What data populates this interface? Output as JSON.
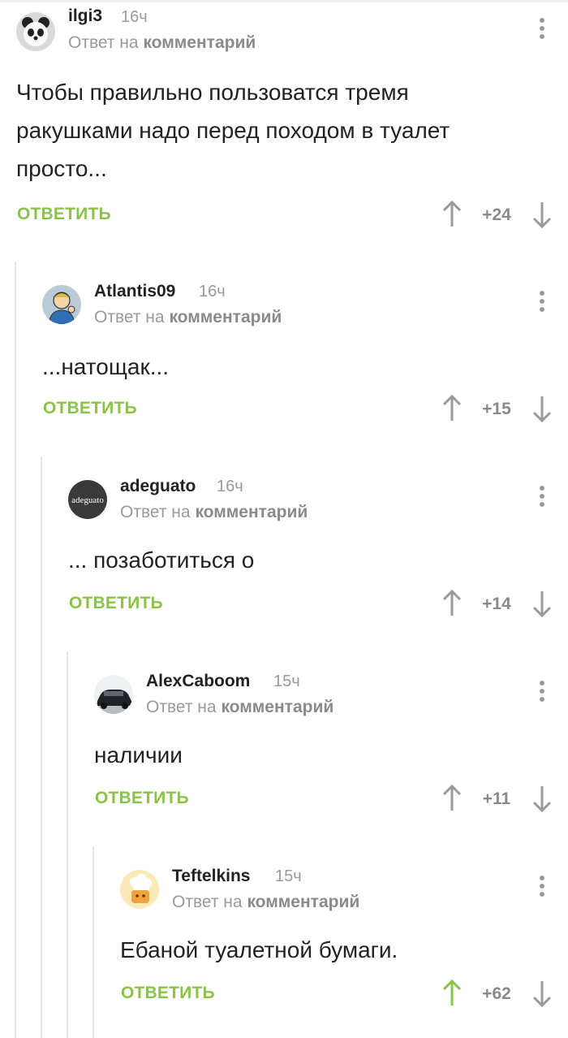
{
  "reply_prefix": "Ответ на",
  "reply_target": "комментарий",
  "reply_button": "ОТВЕТИТЬ",
  "colors": {
    "accent_green": "#8bc34a",
    "muted": "#9a9a9a",
    "thread_line": "#e6e6e6"
  },
  "comments": [
    {
      "user": "ilgi3",
      "time": "16ч",
      "avatar": "panda-avatar",
      "text": [
        "Чтобы правильно пользоватся тремя",
        "ракушками надо перед походом в туалет",
        "просто..."
      ],
      "rating": "+24",
      "upvoted": false
    },
    {
      "user": "Atlantis09",
      "time": "16ч",
      "avatar": "vault-boy-avatar",
      "text": [
        "...натощак..."
      ],
      "rating": "+15",
      "upvoted": false
    },
    {
      "user": "adeguato",
      "time": "16ч",
      "avatar": "adeguato-avatar",
      "avatar_text": "adeguato",
      "text": [
        "... позаботиться о"
      ],
      "rating": "+14",
      "upvoted": false
    },
    {
      "user": "AlexCaboom",
      "time": "15ч",
      "avatar": "car-avatar",
      "text": [
        "наличии"
      ],
      "rating": "+11",
      "upvoted": false
    },
    {
      "user": "Teftelkins",
      "time": "15ч",
      "avatar": "chef-avatar",
      "text": [
        "Ебаной туалетной бумаги."
      ],
      "rating": "+62",
      "upvoted": true
    }
  ]
}
